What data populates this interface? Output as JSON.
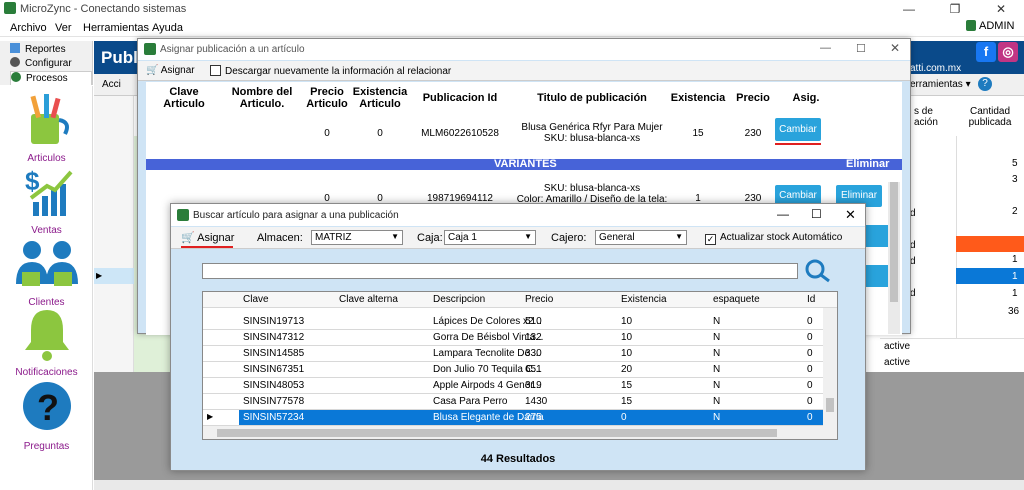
{
  "window": {
    "title": "MicroZync - Conectando sistemas",
    "controls": [
      "—",
      "❐",
      "✕"
    ],
    "user": "ADMIN"
  },
  "menu": [
    "Archivo",
    "Ver",
    "Herramientas",
    "Ayuda"
  ],
  "nav_tabs": [
    "Reportes",
    "Configurar",
    "Procesos"
  ],
  "sidebar": [
    {
      "label": "Articulos",
      "icon": "articles-icon"
    },
    {
      "label": "Ventas",
      "icon": "sales-chart-icon"
    },
    {
      "label": "Clientes",
      "icon": "clients-icon"
    },
    {
      "label": "Notificaciones",
      "icon": "bell-icon"
    },
    {
      "label": "Preguntas",
      "icon": "question-icon"
    }
  ],
  "background": {
    "title": "Publi",
    "email": "atti.com.mx",
    "toolbar_left": "Acci",
    "toolbar_right": "erramientas ▾",
    "col_headers": [
      "s de\nación",
      "Cantidad\npublicada"
    ],
    "qty_values": [
      "5",
      "3",
      "",
      "2",
      "",
      "1",
      "1",
      "1",
      "36"
    ],
    "status_values": [
      "d",
      "d",
      "d",
      "d"
    ],
    "active_values": [
      "active",
      "active"
    ]
  },
  "assign_dialog": {
    "title": "Asignar publicación a un artículo",
    "toolbar_button": "Asignar",
    "checkbox_label": "Descargar nuevamente la información al relacionar",
    "headers": [
      "Clave\nArticulo",
      "Nombre del\nArticulo.",
      "Precio\nArticulo",
      "Existencia\nArticulo",
      "Publicacion Id",
      "Titulo de publicación",
      "Existencia",
      "Precio",
      "Asig."
    ],
    "main_row": {
      "precio_articulo": "0",
      "existencia_articulo": "0",
      "publicacion_id": "MLM6022610528",
      "titulo": "Blusa Genérica Rfyr Para Mujer\nSKU: blusa-blanca-xs",
      "existencia": "15",
      "precio": "230",
      "button": "Cambiar"
    },
    "variantes_label": "VARIANTES",
    "eliminar_label": "Eliminar",
    "variant_row": {
      "precio_articulo": "0",
      "existencia_articulo": "0",
      "publicacion_id": "198719694112",
      "titulo": "SKU: blusa-blanca-xs\nColor: Amarillo / Diseño de la tela:",
      "existencia": "1",
      "precio": "230",
      "button_change": "Cambiar",
      "button_delete": "Eliminar"
    }
  },
  "search_dialog": {
    "title": "Buscar artículo para asignar a una publicación",
    "toolbar_button": "Asignar",
    "almacen_label": "Almacen:",
    "almacen_value": "MATRIZ",
    "caja_label": "Caja:",
    "caja_value": "Caja 1",
    "cajero_label": "Cajero:",
    "cajero_value": "General",
    "stock_checkbox": "Actualizar stock Automático",
    "search_value": "",
    "columns": [
      "Clave",
      "Clave alterna",
      "Descripcion",
      "Precio",
      "Existencia",
      "espaquete",
      "Id"
    ],
    "rows": [
      [
        "SINSIN19713",
        "",
        "Lápices De Colores x2...",
        "510",
        "10",
        "N",
        "0"
      ],
      [
        "SINSIN47312",
        "",
        "Gorra De Béisbol Vinta...",
        "132",
        "10",
        "N",
        "0"
      ],
      [
        "SINSIN14585",
        "",
        "Lampara Tecnolite De ...",
        "330",
        "10",
        "N",
        "0"
      ],
      [
        "SINSIN67351",
        "",
        "Don Julio 70 Tequila C...",
        "651",
        "20",
        "N",
        "0"
      ],
      [
        "SINSIN48053",
        "",
        "Apple Airpods 4 Gener...",
        "319",
        "15",
        "N",
        "0"
      ],
      [
        "SINSIN77578",
        "",
        "Casa Para Perro",
        "1430",
        "15",
        "N",
        "0"
      ],
      [
        "SINSIN57234",
        "",
        "Blusa Elegante de Dama",
        "275",
        "0",
        "N",
        "0"
      ]
    ],
    "results": "44 Resultados"
  },
  "colors": {
    "accent_blue": "#29a3dc",
    "selection": "#0a78d7",
    "variantes_bar": "#4763d8",
    "header_blue": "#0a4a8a"
  }
}
